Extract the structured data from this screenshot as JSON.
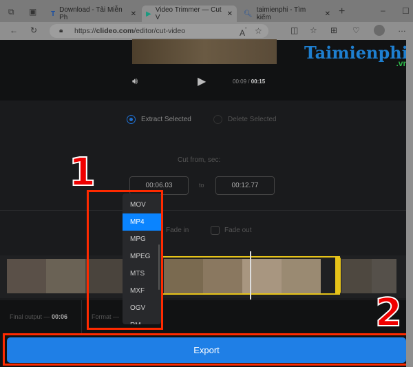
{
  "browser": {
    "tabs": [
      {
        "label": "Download - Tải Miễn Ph"
      },
      {
        "label": "Video Trimmer — Cut V"
      },
      {
        "label": "taimienphi - Tìm kiếm"
      }
    ],
    "url_prefix": "https://",
    "url_domain": "clideo.com",
    "url_path": "/editor/cut-video"
  },
  "player": {
    "current_time": "00:09",
    "separator": "/",
    "duration": "00:15"
  },
  "watermark": {
    "brand": "Taimienphi",
    "tld": ".vn"
  },
  "mode": {
    "extract_label": "Extract Selected",
    "delete_label": "Delete Selected"
  },
  "cut": {
    "label": "Cut from, sec:",
    "from": "00:06.03",
    "to_label": "to",
    "to": "00:12.77"
  },
  "fade": {
    "fade_in": "Fade in",
    "fade_out": "Fade out"
  },
  "format_dropdown": {
    "options": [
      "MOV",
      "MP4",
      "MPG",
      "MPEG",
      "MTS",
      "MXF",
      "OGV",
      "RM"
    ],
    "selected": "MP4"
  },
  "footer": {
    "final_output_label": "Final output —",
    "final_output_value": "00:06",
    "format_label": "Format —"
  },
  "export_label": "Export",
  "annotations": {
    "step1": "1",
    "step2": "2"
  },
  "colors": {
    "accent": "#1f7fe6",
    "highlight": "#e6c319",
    "annotation": "#ff2a00"
  }
}
